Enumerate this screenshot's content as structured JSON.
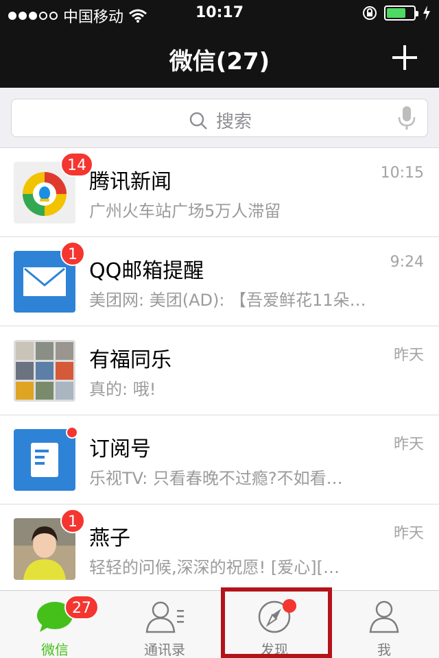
{
  "status_bar": {
    "carrier": "中国移动",
    "time": "10:17",
    "signal_dots_filled": 3,
    "signal_dots_total": 5,
    "battery_level": 0.7
  },
  "nav": {
    "title": "微信(27)",
    "plus_icon": "plus-icon"
  },
  "search": {
    "placeholder": "搜索",
    "icon": "search-icon",
    "mic_icon": "microphone-icon"
  },
  "chats": [
    {
      "name": "腾讯新闻",
      "time": "10:15",
      "message": "广州火车站广场5万人滞留",
      "badge": "14",
      "avatar": "tencent-news"
    },
    {
      "name": "QQ邮箱提醒",
      "time": "9:24",
      "message": "美团网: 美团(AD): 【吾爱鲜花11朵…",
      "badge": "1",
      "avatar": "qq-mail"
    },
    {
      "name": "有福同乐",
      "time": "昨天",
      "message": "真的: 哦!",
      "badge": "",
      "avatar": "group-grid"
    },
    {
      "name": "订阅号",
      "time": "昨天",
      "message": "乐视TV: 只看春晚不过瘾?不如看…",
      "badge": "dot",
      "avatar": "subscription"
    },
    {
      "name": "燕子",
      "time": "昨天",
      "message": " 轻轻的问候,深深的祝愿! [爱心][…",
      "badge": "1",
      "avatar": "photo"
    }
  ],
  "tabs": [
    {
      "label": "微信",
      "icon": "chat-bubble-icon",
      "badge": "27",
      "active": true
    },
    {
      "label": "通讯录",
      "icon": "contacts-icon",
      "badge": "",
      "active": false
    },
    {
      "label": "发现",
      "icon": "compass-icon",
      "badge": "dot",
      "active": false
    },
    {
      "label": "我",
      "icon": "person-icon",
      "badge": "",
      "active": false
    }
  ],
  "colors": {
    "nav_bg": "#131313",
    "accent_green": "#45c01a",
    "badge_red": "#f43530",
    "highlight_border": "#b3141a"
  }
}
